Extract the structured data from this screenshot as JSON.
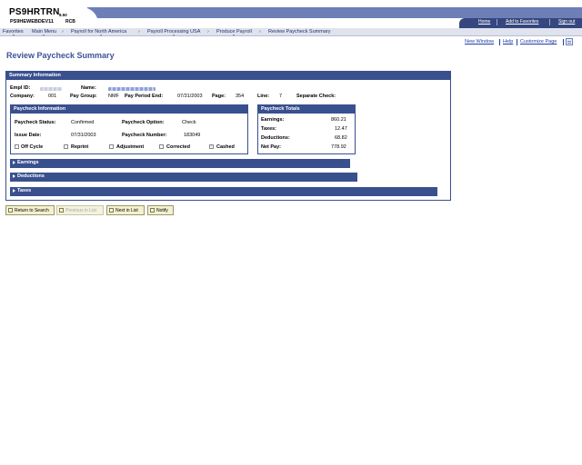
{
  "header": {
    "app_title": "PS9HRTRN",
    "app_version": "8.50",
    "db_name": "PS9HEWEBDEV11",
    "db_extra": "RCB",
    "links": [
      "Home",
      "Add to Favorites",
      "Sign out"
    ]
  },
  "menubar": {
    "items": [
      "Favorites",
      "Main Menu",
      "Payroll for North America",
      "Payroll Processing USA",
      "Produce Payroll",
      "Review Paycheck Summary"
    ]
  },
  "utility_links": [
    "New Window",
    "Help",
    "Customize Page"
  ],
  "page": {
    "title": "Review Paycheck Summary"
  },
  "summary": {
    "header": "Summary Information",
    "labels": {
      "empl_id": "Empl ID:",
      "name": "Name:",
      "company": "Company:",
      "pay_group": "Pay Group:",
      "pay_period_end": "Pay Period End:",
      "page": "Page:",
      "line": "Line:",
      "separate_check": "Separate Check:"
    },
    "values": {
      "company": "001",
      "pay_group": "NMF",
      "pay_period_end": "07/31/2003",
      "page": "354",
      "line": "7"
    }
  },
  "paycheck_info": {
    "header": "Paycheck Information",
    "labels": {
      "status": "Paycheck Status:",
      "option": "Paycheck Option:",
      "issue_date": "Issue Date:",
      "number": "Paycheck Number:"
    },
    "values": {
      "status": "Confirmed",
      "option": "Check",
      "issue_date": "07/31/2003",
      "number": "183049"
    },
    "checkboxes": [
      {
        "label": "Off Cycle",
        "checked": false
      },
      {
        "label": "Reprint",
        "checked": false
      },
      {
        "label": "Adjustment",
        "checked": false
      },
      {
        "label": "Corrected",
        "checked": false
      },
      {
        "label": "Cashed",
        "checked": true
      }
    ]
  },
  "paycheck_totals": {
    "header": "Paycheck Totals",
    "rows": [
      {
        "label": "Earnings:",
        "value": "860.21"
      },
      {
        "label": "Taxes:",
        "value": "12.47"
      },
      {
        "label": "Deductions:",
        "value": "68.82"
      },
      {
        "label": "Net Pay:",
        "value": "778.92"
      }
    ]
  },
  "sections": [
    "Earnings",
    "Deductions",
    "Taxes"
  ],
  "buttons": [
    {
      "label": "Return to Search",
      "enabled": true
    },
    {
      "label": "Previous in List",
      "enabled": false
    },
    {
      "label": "Next in List",
      "enabled": true
    },
    {
      "label": "Notify",
      "enabled": true
    }
  ]
}
